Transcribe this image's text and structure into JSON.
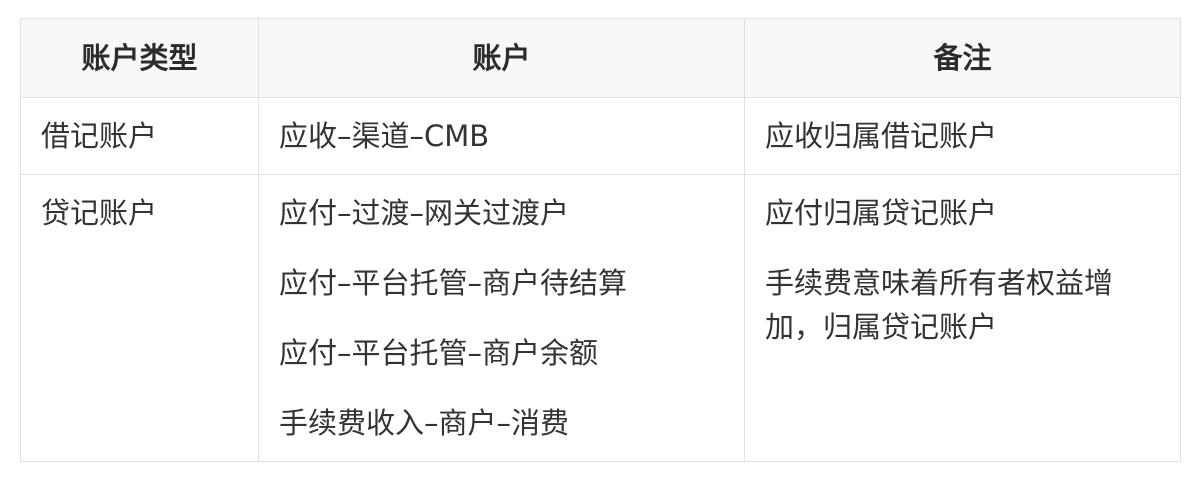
{
  "table": {
    "headers": [
      "账户类型",
      "账户",
      "备注"
    ],
    "rows": [
      {
        "type": "借记账户",
        "accounts": [
          "应收–渠道–CMB"
        ],
        "notes": [
          "应收归属借记账户"
        ]
      },
      {
        "type": "贷记账户",
        "accounts": [
          "应付–过渡–网关过渡户",
          "应付–平台托管–商户待结算",
          "应付–平台托管–商户余额",
          "手续费收入–商户–消费"
        ],
        "notes": [
          "应付归属贷记账户",
          "手续费意味着所有者权益增加，归属贷记账户"
        ]
      }
    ]
  },
  "colors": {
    "header_bg": "#f6f8fa",
    "border": "#dfe2e5",
    "text": "#333333"
  }
}
